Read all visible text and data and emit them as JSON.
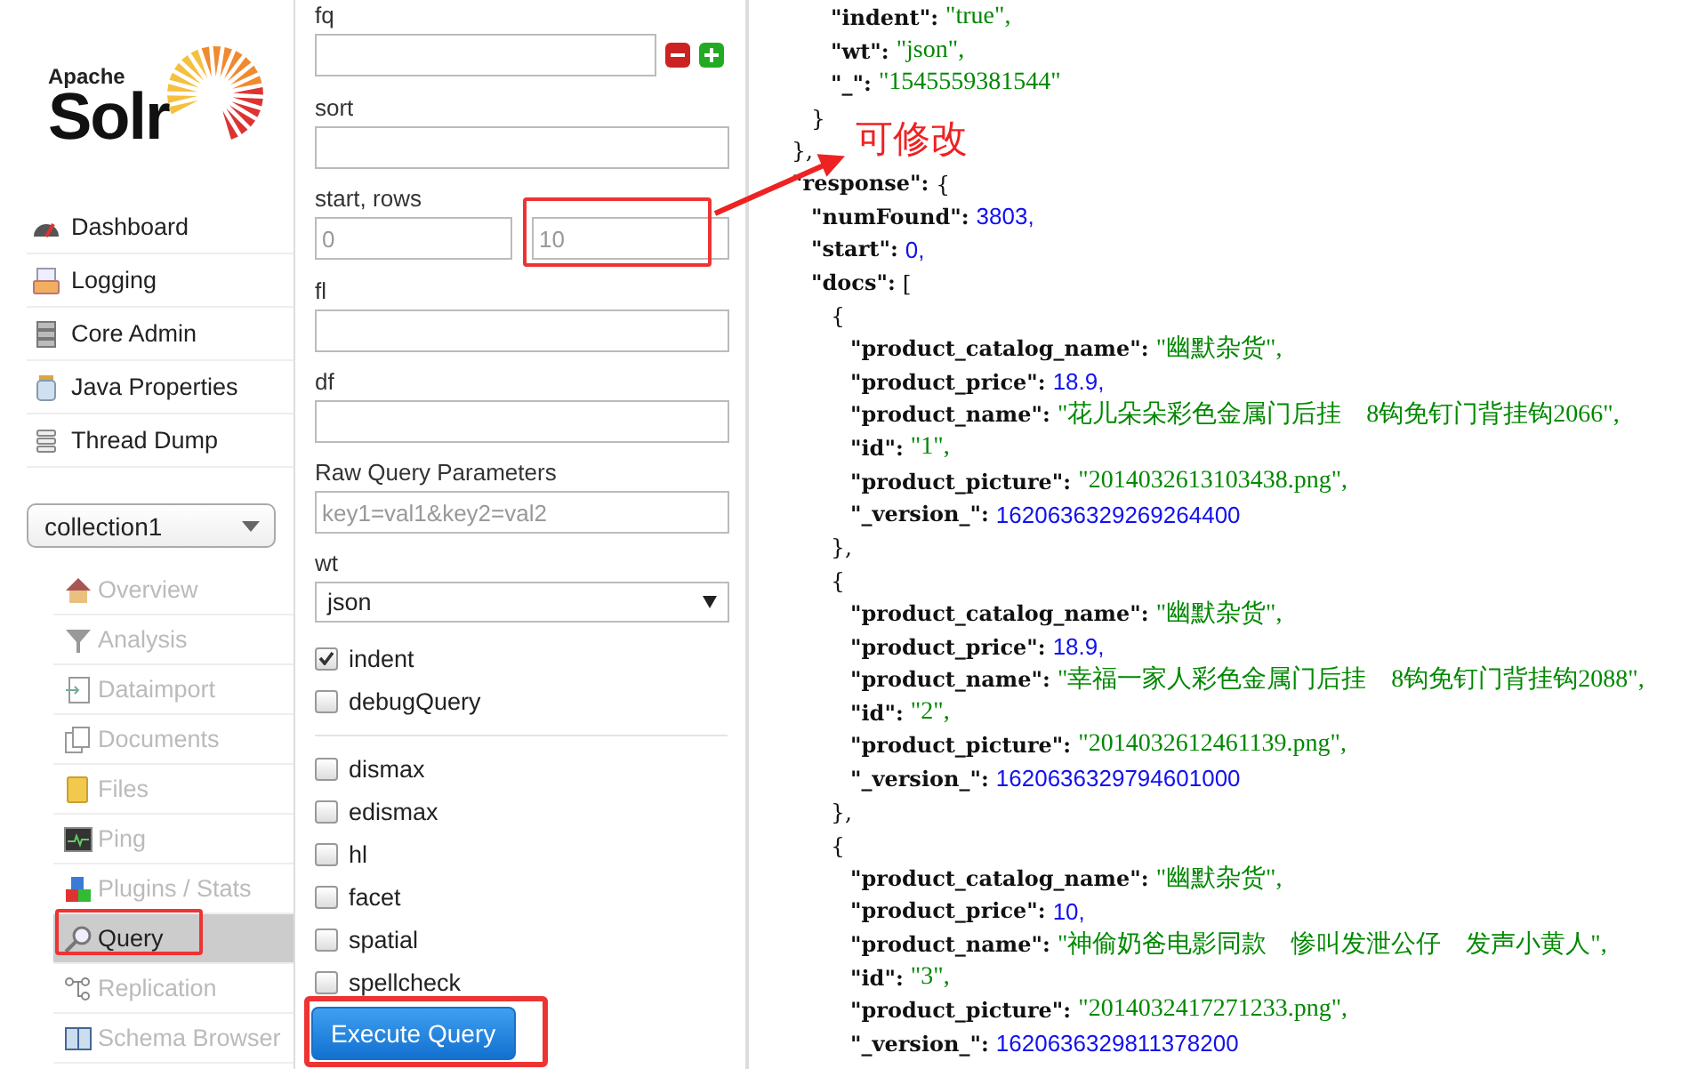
{
  "logo": {
    "small": "Apache",
    "big": "Solr"
  },
  "nav": [
    {
      "label": "Dashboard"
    },
    {
      "label": "Logging"
    },
    {
      "label": "Core Admin"
    },
    {
      "label": "Java Properties"
    },
    {
      "label": "Thread Dump"
    }
  ],
  "core_selector": {
    "value": "collection1"
  },
  "core_menu": [
    {
      "label": "Overview",
      "selected": false,
      "highlighted": false
    },
    {
      "label": "Analysis",
      "selected": false,
      "highlighted": false
    },
    {
      "label": "Dataimport",
      "selected": false,
      "highlighted": false
    },
    {
      "label": "Documents",
      "selected": false,
      "highlighted": false
    },
    {
      "label": "Files",
      "selected": false,
      "highlighted": false
    },
    {
      "label": "Ping",
      "selected": false,
      "highlighted": false
    },
    {
      "label": "Plugins / Stats",
      "selected": false,
      "highlighted": false
    },
    {
      "label": "Query",
      "selected": true,
      "highlighted": true
    },
    {
      "label": "Replication",
      "selected": false,
      "highlighted": false
    },
    {
      "label": "Schema Browser",
      "selected": false,
      "highlighted": false
    }
  ],
  "form": {
    "fields": [
      {
        "kind": "filter",
        "label": "fq"
      },
      {
        "kind": "text",
        "label": "sort"
      },
      {
        "kind": "pair",
        "label": "start, rows",
        "inputs": [
          {
            "placeholder": "0",
            "highlighted": false
          },
          {
            "placeholder": "10",
            "highlighted": true
          }
        ]
      },
      {
        "kind": "text",
        "label": "fl"
      },
      {
        "kind": "text",
        "label": "df"
      },
      {
        "kind": "text",
        "label": "Raw Query Parameters",
        "placeholder": "key1=val1&key2=val2"
      },
      {
        "kind": "select",
        "label": "wt",
        "value": "json"
      }
    ],
    "options": [
      {
        "label": "indent",
        "checked": true
      },
      {
        "label": "debugQuery",
        "checked": false
      }
    ],
    "parsers": [
      {
        "label": "dismax",
        "checked": false
      },
      {
        "label": "edismax",
        "checked": false
      },
      {
        "label": "hl",
        "checked": false
      },
      {
        "label": "facet",
        "checked": false
      },
      {
        "label": "spatial",
        "checked": false
      },
      {
        "label": "spellcheck",
        "checked": false
      }
    ],
    "submit": {
      "label": "Execute Query",
      "highlighted": true
    }
  },
  "note": {
    "text": "可修改"
  },
  "result": {
    "lines": [
      {
        "close": "},",
        "children": [
          {
            "close": "}",
            "children": [
              {
                "key": "\"indent\":",
                "value": "\"true\",",
                "kind": "string"
              },
              {
                "key": "\"wt\":",
                "value": "\"json\",",
                "kind": "string"
              },
              {
                "key": "\"_\":",
                "value": "\"1545559381544\"",
                "kind": "string"
              }
            ]
          }
        ]
      },
      {
        "key": "\"response\":",
        "bracket": "{",
        "children": [
          {
            "key": "\"numFound\":",
            "value": "3803,",
            "kind": "number"
          },
          {
            "key": "\"start\":",
            "value": "0,",
            "kind": "number"
          },
          {
            "key": "\"docs\":",
            "bracket": "[",
            "children": [
              {
                "bracket": "{",
                "close": "},",
                "children": [
                  {
                    "key": "\"product_catalog_name\":",
                    "value": "\"幽默杂货\",",
                    "kind": "string"
                  },
                  {
                    "key": "\"product_price\":",
                    "value": "18.9,",
                    "kind": "number"
                  },
                  {
                    "key": "\"product_name\":",
                    "value": "\"花儿朵朵彩色金属门后挂　8钩免钉门背挂钩2066\",",
                    "kind": "string"
                  },
                  {
                    "key": "\"id\":",
                    "value": "\"1\",",
                    "kind": "string"
                  },
                  {
                    "key": "\"product_picture\":",
                    "value": "\"2014032613103438.png\",",
                    "kind": "string"
                  },
                  {
                    "key": "\"_version_\":",
                    "value": "1620636329269264400",
                    "kind": "number"
                  }
                ]
              },
              {
                "bracket": "{",
                "close": "},",
                "children": [
                  {
                    "key": "\"product_catalog_name\":",
                    "value": "\"幽默杂货\",",
                    "kind": "string"
                  },
                  {
                    "key": "\"product_price\":",
                    "value": "18.9,",
                    "kind": "number"
                  },
                  {
                    "key": "\"product_name\":",
                    "value": "\"幸福一家人彩色金属门后挂　8钩免钉门背挂钩2088\",",
                    "kind": "string"
                  },
                  {
                    "key": "\"id\":",
                    "value": "\"2\",",
                    "kind": "string"
                  },
                  {
                    "key": "\"product_picture\":",
                    "value": "\"2014032612461139.png\",",
                    "kind": "string"
                  },
                  {
                    "key": "\"_version_\":",
                    "value": "1620636329794601000",
                    "kind": "number"
                  }
                ]
              },
              {
                "bracket": "{",
                "children": [
                  {
                    "key": "\"product_catalog_name\":",
                    "value": "\"幽默杂货\",",
                    "kind": "string"
                  },
                  {
                    "key": "\"product_price\":",
                    "value": "10,",
                    "kind": "number"
                  },
                  {
                    "key": "\"product_name\":",
                    "value": "\"神偷奶爸电影同款　惨叫发泄公仔　发声小黄人\",",
                    "kind": "string"
                  },
                  {
                    "key": "\"id\":",
                    "value": "\"3\",",
                    "kind": "string"
                  },
                  {
                    "key": "\"product_picture\":",
                    "value": "\"2014032417271233.png\",",
                    "kind": "string"
                  },
                  {
                    "key": "\"_version_\":",
                    "value": "1620636329811378200",
                    "kind": "number"
                  }
                ]
              }
            ]
          }
        ]
      }
    ]
  }
}
